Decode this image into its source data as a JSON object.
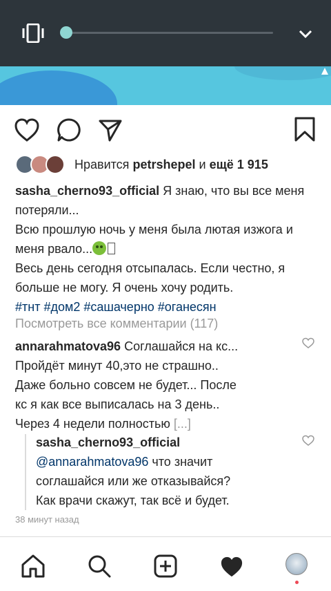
{
  "likes": {
    "prefix": "Нравится",
    "user": "petrshepel",
    "connector": "и",
    "more": "ещё 1 915"
  },
  "caption": {
    "username": "sasha_cherno93_official",
    "line1": "Я знаю, что вы все меня потеряли...",
    "line2": "Всю прошлую ночь у меня была лютая изжога и меня рвало...",
    "line3": "Весь день сегодня отсыпалась. Если честно, я больше не могу. Я очень хочу родить.",
    "hashtags": "#тнт #дом2 #сашачерно #оганесян"
  },
  "view_all": "Посмотреть все комментарии (117)",
  "comment1": {
    "username": "annarahmatova96",
    "line1": "Соглашайся на кс...",
    "line2": "Пройдёт минут 40,это не страшно..",
    "line3": "Даже больно совсем не будет... После",
    "line4": "кс я как все выписалась на 3 день..",
    "line5": "Через 4 недели полностью",
    "more": "[...]"
  },
  "reply": {
    "username": "sasha_cherno93_official",
    "mention": "@annarahmatova96",
    "line1": " что значит",
    "line2": "соглашайся или же отказывайся?",
    "line3": "Как врачи скажут, так всё и будет."
  },
  "time_ago": "38 минут назад",
  "icons": {
    "like": "heart-icon",
    "comment": "comment-icon",
    "share": "send-icon",
    "save": "bookmark-icon",
    "home": "home-icon",
    "search": "search-icon",
    "add": "add-post-icon",
    "activity": "activity-heart-icon"
  },
  "colors": {
    "topbar": "#2d353b",
    "slider_knob": "#8fd6d2",
    "link": "#003569",
    "muted": "#999999",
    "notification_dot": "#ed4956"
  }
}
